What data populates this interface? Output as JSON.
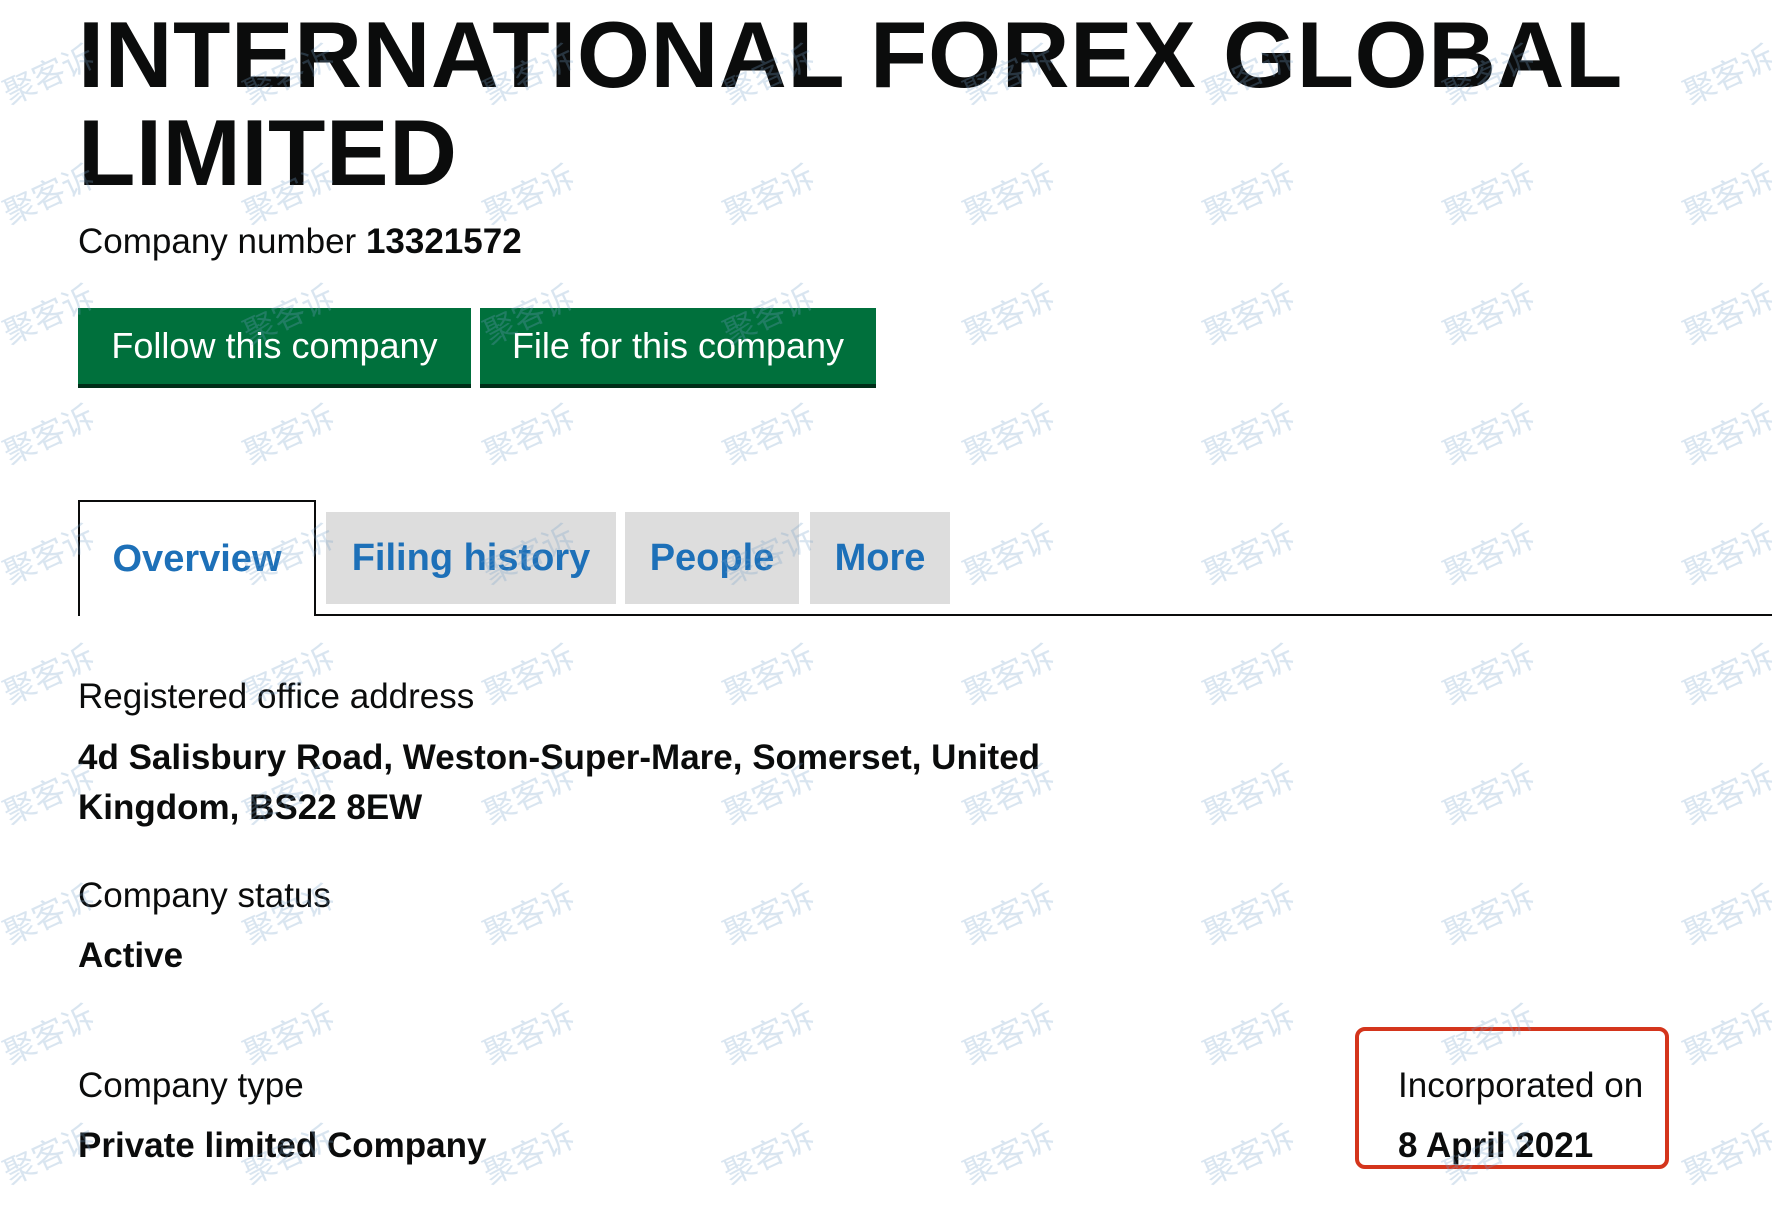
{
  "header": {
    "company_name": "INTERNATIONAL FOREX GLOBAL LIMITED",
    "company_number_label": "Company number",
    "company_number": "13321572"
  },
  "actions": {
    "follow_label": "Follow this company",
    "file_label": "File for this company"
  },
  "tabs": [
    {
      "label": "Overview",
      "active": true
    },
    {
      "label": "Filing history",
      "active": false
    },
    {
      "label": "People",
      "active": false
    },
    {
      "label": "More",
      "active": false
    }
  ],
  "overview": {
    "registered_office_label": "Registered office address",
    "registered_office_value": "4d Salisbury Road, Weston-Super-Mare, Somerset, United Kingdom, BS22 8EW",
    "status_label": "Company status",
    "status_value": "Active",
    "type_label": "Company type",
    "type_value": "Private limited Company",
    "incorporated_label": "Incorporated on",
    "incorporated_value": "8 April 2021"
  },
  "watermark": {
    "text": "聚客诉"
  },
  "colors": {
    "button_green": "#00703c",
    "link_blue": "#1d70b8",
    "highlight_red": "#d4351c",
    "tab_inactive_bg": "#dddddd"
  }
}
